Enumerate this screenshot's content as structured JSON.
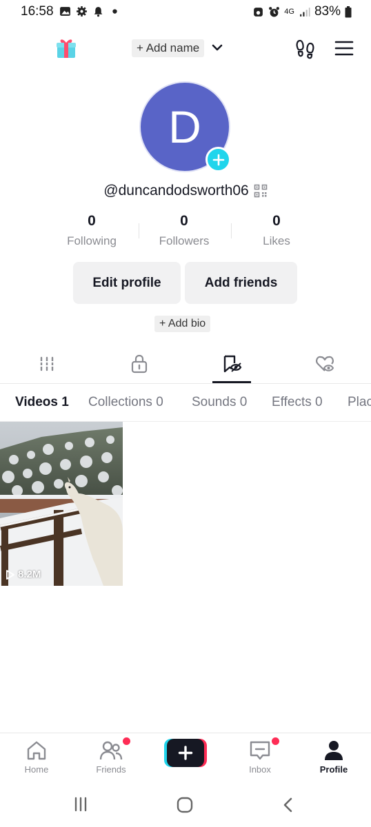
{
  "status_bar": {
    "time": "16:58",
    "network": "4G",
    "battery": "83%"
  },
  "header": {
    "add_name": "+ Add name",
    "gift_icon": "gift-icon",
    "footprint_icon": "footprint-icon",
    "menu_icon": "hamburger-menu-icon"
  },
  "profile": {
    "avatar_letter": "D",
    "avatar_color": "#5964c7",
    "username": "@duncandodsworth06",
    "stats": [
      {
        "value": "0",
        "label": "Following"
      },
      {
        "value": "0",
        "label": "Followers"
      },
      {
        "value": "0",
        "label": "Likes"
      }
    ],
    "edit_profile": "Edit profile",
    "add_friends": "Add friends",
    "add_bio": "+ Add bio"
  },
  "content_tabs": {
    "icons": [
      "grid-icon",
      "lock-icon",
      "saved-icon",
      "liked-hidden-icon"
    ],
    "active_index": 2
  },
  "sub_tabs": [
    {
      "label": "Videos 1",
      "active": true
    },
    {
      "label": "Collections 0",
      "active": false
    },
    {
      "label": "Sounds 0",
      "active": false
    },
    {
      "label": "Effects 0",
      "active": false
    },
    {
      "label": "Plac",
      "active": false
    }
  ],
  "videos": [
    {
      "views": "8.2M"
    }
  ],
  "bottom_nav": [
    {
      "label": "Home",
      "icon": "home-icon",
      "active": false
    },
    {
      "label": "Friends",
      "icon": "friends-icon",
      "active": false
    },
    {
      "label": "",
      "icon": "create-icon",
      "active": false
    },
    {
      "label": "Inbox",
      "icon": "inbox-icon",
      "active": false
    },
    {
      "label": "Profile",
      "icon": "profile-icon",
      "active": true
    }
  ],
  "colors": {
    "accent_cyan": "#20d5ec",
    "accent_red": "#fe2c55",
    "text_primary": "#161823"
  }
}
